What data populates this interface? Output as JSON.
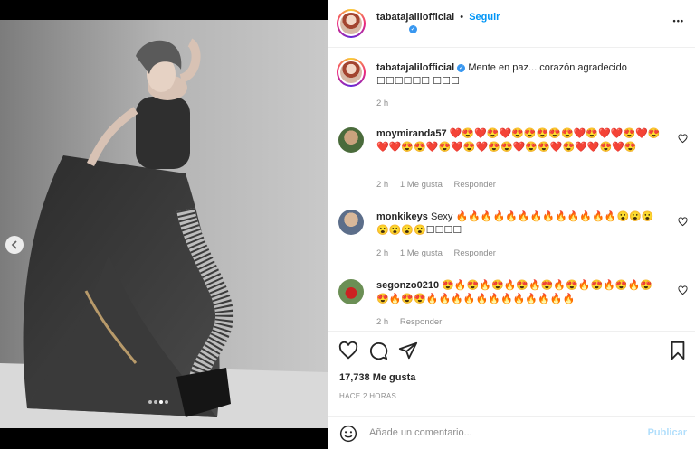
{
  "post": {
    "author": "tabatajalilofficial",
    "follow_label": "Seguir",
    "more_label": "•••",
    "separator": "•",
    "verified_glyph": "✓"
  },
  "media": {
    "carousel_total": 4,
    "carousel_active": 3,
    "prev_icon": "chevron-left-icon"
  },
  "caption": {
    "username": "tabatajalilofficial",
    "text": "Mente en paz... corazón agradecido ☐☐☐☐☐☐ ☐☐☐",
    "time": "2 h"
  },
  "comments": [
    {
      "username": "moymiranda57",
      "text": "❤️😍❤️😍❤️😍😍😍😍😍❤️😍❤️❤️😍❤️😍❤️❤️😍😍❤️😍❤️😍❤️😍😍❤️😍😍❤️😍❤️❤️😍❤️😍",
      "time": "2 h",
      "likes": "1 Me gusta",
      "reply": "Responder"
    },
    {
      "username": "monkikeys",
      "text": "Sexy 🔥🔥🔥🔥🔥🔥🔥🔥🔥🔥🔥🔥🔥😮😮😮😮😮😮😮☐☐☐☐",
      "time": "2 h",
      "likes": "1 Me gusta",
      "reply": "Responder"
    },
    {
      "username": "segonzo0210",
      "text": "😍🔥😍🔥😍🔥😍🔥😍🔥😍🔥😍🔥😍🔥😍😍🔥😍😍🔥🔥🔥🔥🔥🔥🔥🔥🔥🔥🔥🔥",
      "time": "2 h",
      "reply": "Responder"
    }
  ],
  "stats": {
    "likes": "17,738 Me gusta",
    "posted": "HACE 2 HORAS"
  },
  "add_comment": {
    "placeholder": "Añade un comentario...",
    "publish_label": "Publicar"
  },
  "colors": {
    "link": "#0095f6",
    "publish_disabled": "#b2dffc",
    "muted": "#8e8e8e",
    "verified": "#3897f0"
  },
  "icons": [
    "heart-icon",
    "comment-icon",
    "share-icon",
    "bookmark-icon",
    "emoji-icon",
    "more-icon",
    "verified-icon"
  ]
}
